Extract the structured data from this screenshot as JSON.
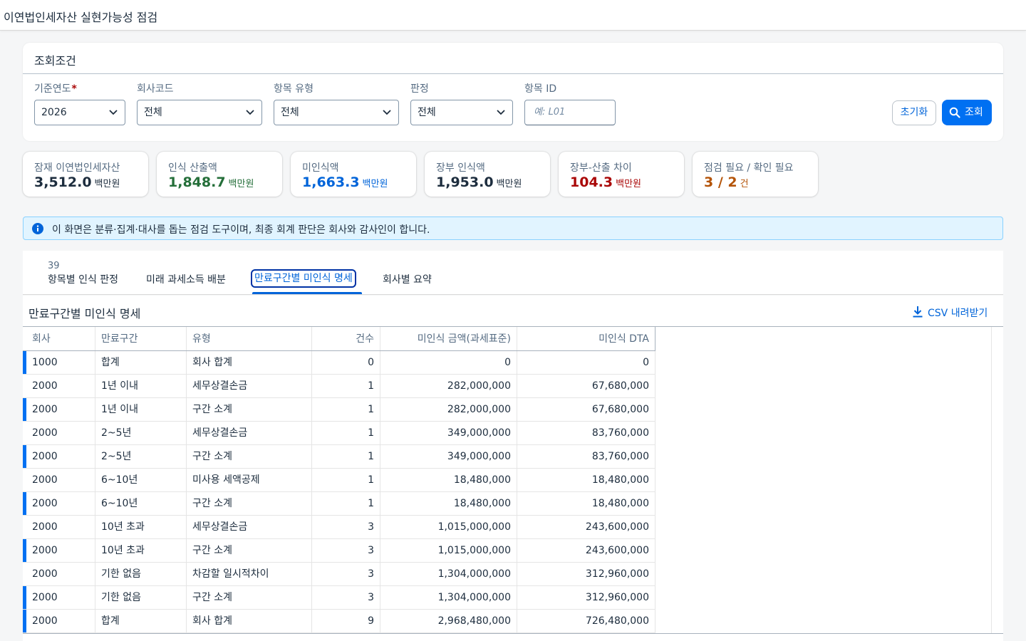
{
  "app": {
    "title": "이연법인세자산 실현가능성 점검"
  },
  "filter": {
    "header": "조회조건",
    "fields": [
      {
        "label": "기준연도",
        "required": true,
        "value": "2026"
      },
      {
        "label": "회사코드",
        "value": "전체"
      },
      {
        "label": "항목 유형",
        "value": "전체"
      },
      {
        "label": "판정",
        "value": "전체"
      },
      {
        "label": "항목 ID",
        "placeholder": "예: L01"
      }
    ],
    "reset_label": "초기화",
    "search_label": "조회"
  },
  "kpis": [
    {
      "label": "잠재 이연법인세자산",
      "value": "3,512.0",
      "unit": "백만원",
      "color": "#1d2d3e"
    },
    {
      "label": "인식 산출액",
      "value": "1,848.7",
      "unit": "백만원",
      "color": "#256f3a"
    },
    {
      "label": "미인식액",
      "value": "1,663.3",
      "unit": "백만원",
      "color": "#0064d9"
    },
    {
      "label": "장부 인식액",
      "value": "1,953.0",
      "unit": "백만원",
      "color": "#1d2d3e"
    },
    {
      "label": "장부-산출 차이",
      "value": "104.3",
      "unit": "백만원",
      "color": "#aa0808"
    },
    {
      "label": "점검 필요 / 확인 필요",
      "value": "3 / 2",
      "unit": "건",
      "color": "#b45409"
    }
  ],
  "info": {
    "text": "이 화면은 분류·집계·대사를 돕는 점검 도구이며, 최종 회계 판단은 회사와 감사인이 합니다."
  },
  "tabs": [
    {
      "label": "항목별 인식 판정",
      "count": "39"
    },
    {
      "label": "미래 과세소득 배분"
    },
    {
      "label": "만료구간별 미인식 명세",
      "selected": true
    },
    {
      "label": "회사별 요약"
    }
  ],
  "panel": {
    "title": "만료구간별 미인식 명세",
    "csv_label": "CSV 내려받기",
    "columns": [
      "회사",
      "만료구간",
      "유형",
      "건수",
      "미인식 금액(과세표준)",
      "미인식 DTA"
    ],
    "rows": [
      {
        "company": "1000",
        "period": "합계",
        "type": "회사 합계",
        "count": "0",
        "amount": "0",
        "dta": "0",
        "marked": true
      },
      {
        "company": "2000",
        "period": "1년 이내",
        "type": "세무상결손금",
        "count": "1",
        "amount": "282,000,000",
        "dta": "67,680,000",
        "marked": false
      },
      {
        "company": "2000",
        "period": "1년 이내",
        "type": "구간 소계",
        "count": "1",
        "amount": "282,000,000",
        "dta": "67,680,000",
        "marked": true
      },
      {
        "company": "2000",
        "period": "2~5년",
        "type": "세무상결손금",
        "count": "1",
        "amount": "349,000,000",
        "dta": "83,760,000",
        "marked": false
      },
      {
        "company": "2000",
        "period": "2~5년",
        "type": "구간 소계",
        "count": "1",
        "amount": "349,000,000",
        "dta": "83,760,000",
        "marked": true
      },
      {
        "company": "2000",
        "period": "6~10년",
        "type": "미사용 세액공제",
        "count": "1",
        "amount": "18,480,000",
        "dta": "18,480,000",
        "marked": false
      },
      {
        "company": "2000",
        "period": "6~10년",
        "type": "구간 소계",
        "count": "1",
        "amount": "18,480,000",
        "dta": "18,480,000",
        "marked": true
      },
      {
        "company": "2000",
        "period": "10년 초과",
        "type": "세무상결손금",
        "count": "3",
        "amount": "1,015,000,000",
        "dta": "243,600,000",
        "marked": false
      },
      {
        "company": "2000",
        "period": "10년 초과",
        "type": "구간 소계",
        "count": "3",
        "amount": "1,015,000,000",
        "dta": "243,600,000",
        "marked": true
      },
      {
        "company": "2000",
        "period": "기한 없음",
        "type": "차감할 일시적차이",
        "count": "3",
        "amount": "1,304,000,000",
        "dta": "312,960,000",
        "marked": false
      },
      {
        "company": "2000",
        "period": "기한 없음",
        "type": "구간 소계",
        "count": "3",
        "amount": "1,304,000,000",
        "dta": "312,960,000",
        "marked": true
      },
      {
        "company": "2000",
        "period": "합계",
        "type": "회사 합계",
        "count": "9",
        "amount": "2,968,480,000",
        "dta": "726,480,000",
        "marked": true
      }
    ]
  },
  "colors": {
    "accent": "#0070f2",
    "link": "#0064d9"
  }
}
